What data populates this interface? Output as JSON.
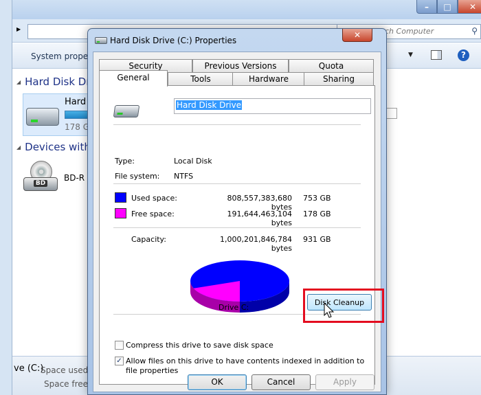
{
  "explorer": {
    "search_placeholder": "Search Computer",
    "toolbar_label": "System prope",
    "hdd_group": "Hard Disk Dr",
    "hdd_name": "Hard",
    "hdd_free": "178 G",
    "devices_group": "Devices with",
    "bd_label": "BD",
    "bd_name": "BD-R",
    "details_drive": "ve (C:)",
    "details_used": "Space used:",
    "details_free": "Space free"
  },
  "dialog": {
    "title": "Hard Disk Drive (C:) Properties",
    "tabs_back": [
      "Security",
      "Previous Versions",
      "Quota"
    ],
    "tabs_front": [
      "General",
      "Tools",
      "Hardware",
      "Sharing"
    ],
    "drive_name": "Hard Disk Drive",
    "type_label": "Type:",
    "type_value": "Local Disk",
    "fs_label": "File system:",
    "fs_value": "NTFS",
    "used_label": "Used space:",
    "used_bytes": "808,557,383,680 bytes",
    "used_gb": "753 GB",
    "free_label": "Free space:",
    "free_bytes": "191,644,463,104 bytes",
    "free_gb": "178 GB",
    "capacity_label": "Capacity:",
    "capacity_bytes": "1,000,201,846,784 bytes",
    "capacity_gb": "931 GB",
    "drive_label": "Drive C:",
    "cleanup_button": "Disk Cleanup",
    "compress_label": "Compress this drive to save disk space",
    "compress_checked": false,
    "index_label": "Allow files on this drive to have contents indexed in addition to file properties",
    "index_checked": true,
    "ok_button": "OK",
    "cancel_button": "Cancel",
    "apply_button": "Apply"
  },
  "colors": {
    "used_space": "#0000ff",
    "free_space": "#ff00ff",
    "highlight": "#e30c1f"
  },
  "disk_usage": {
    "used_fraction": 0.808,
    "free_fraction": 0.192
  }
}
